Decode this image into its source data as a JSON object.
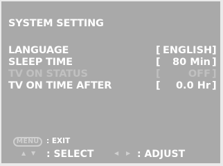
{
  "menu": {
    "title": "SYSTEM SETTING",
    "items": [
      {
        "label": "LANGUAGE",
        "value": "ENGLISH",
        "open": "[",
        "close": "]"
      },
      {
        "label": "SLEEP TIME",
        "value": "80 Min",
        "open": "[",
        "close": "]"
      },
      {
        "label": "TV ON STATUS",
        "value": "OFF",
        "open": "[",
        "close": "]",
        "disabled": true
      },
      {
        "label": "TV ON TIME AFTER",
        "value": "0.0 Hr",
        "open": "[",
        "close": "]"
      }
    ]
  },
  "footer": {
    "menu_key": "MENU",
    "exit": ": EXIT",
    "select": ": SELECT",
    "adjust": ": ADJUST",
    "icons": {
      "up": "▲",
      "down": "▼",
      "left": "◀",
      "right": "▶"
    }
  },
  "colors": {
    "background": "#a9a9a9",
    "text": "#ffffff",
    "disabled_text": "#c0c0c0",
    "key_outline": "#cfcfcf"
  }
}
